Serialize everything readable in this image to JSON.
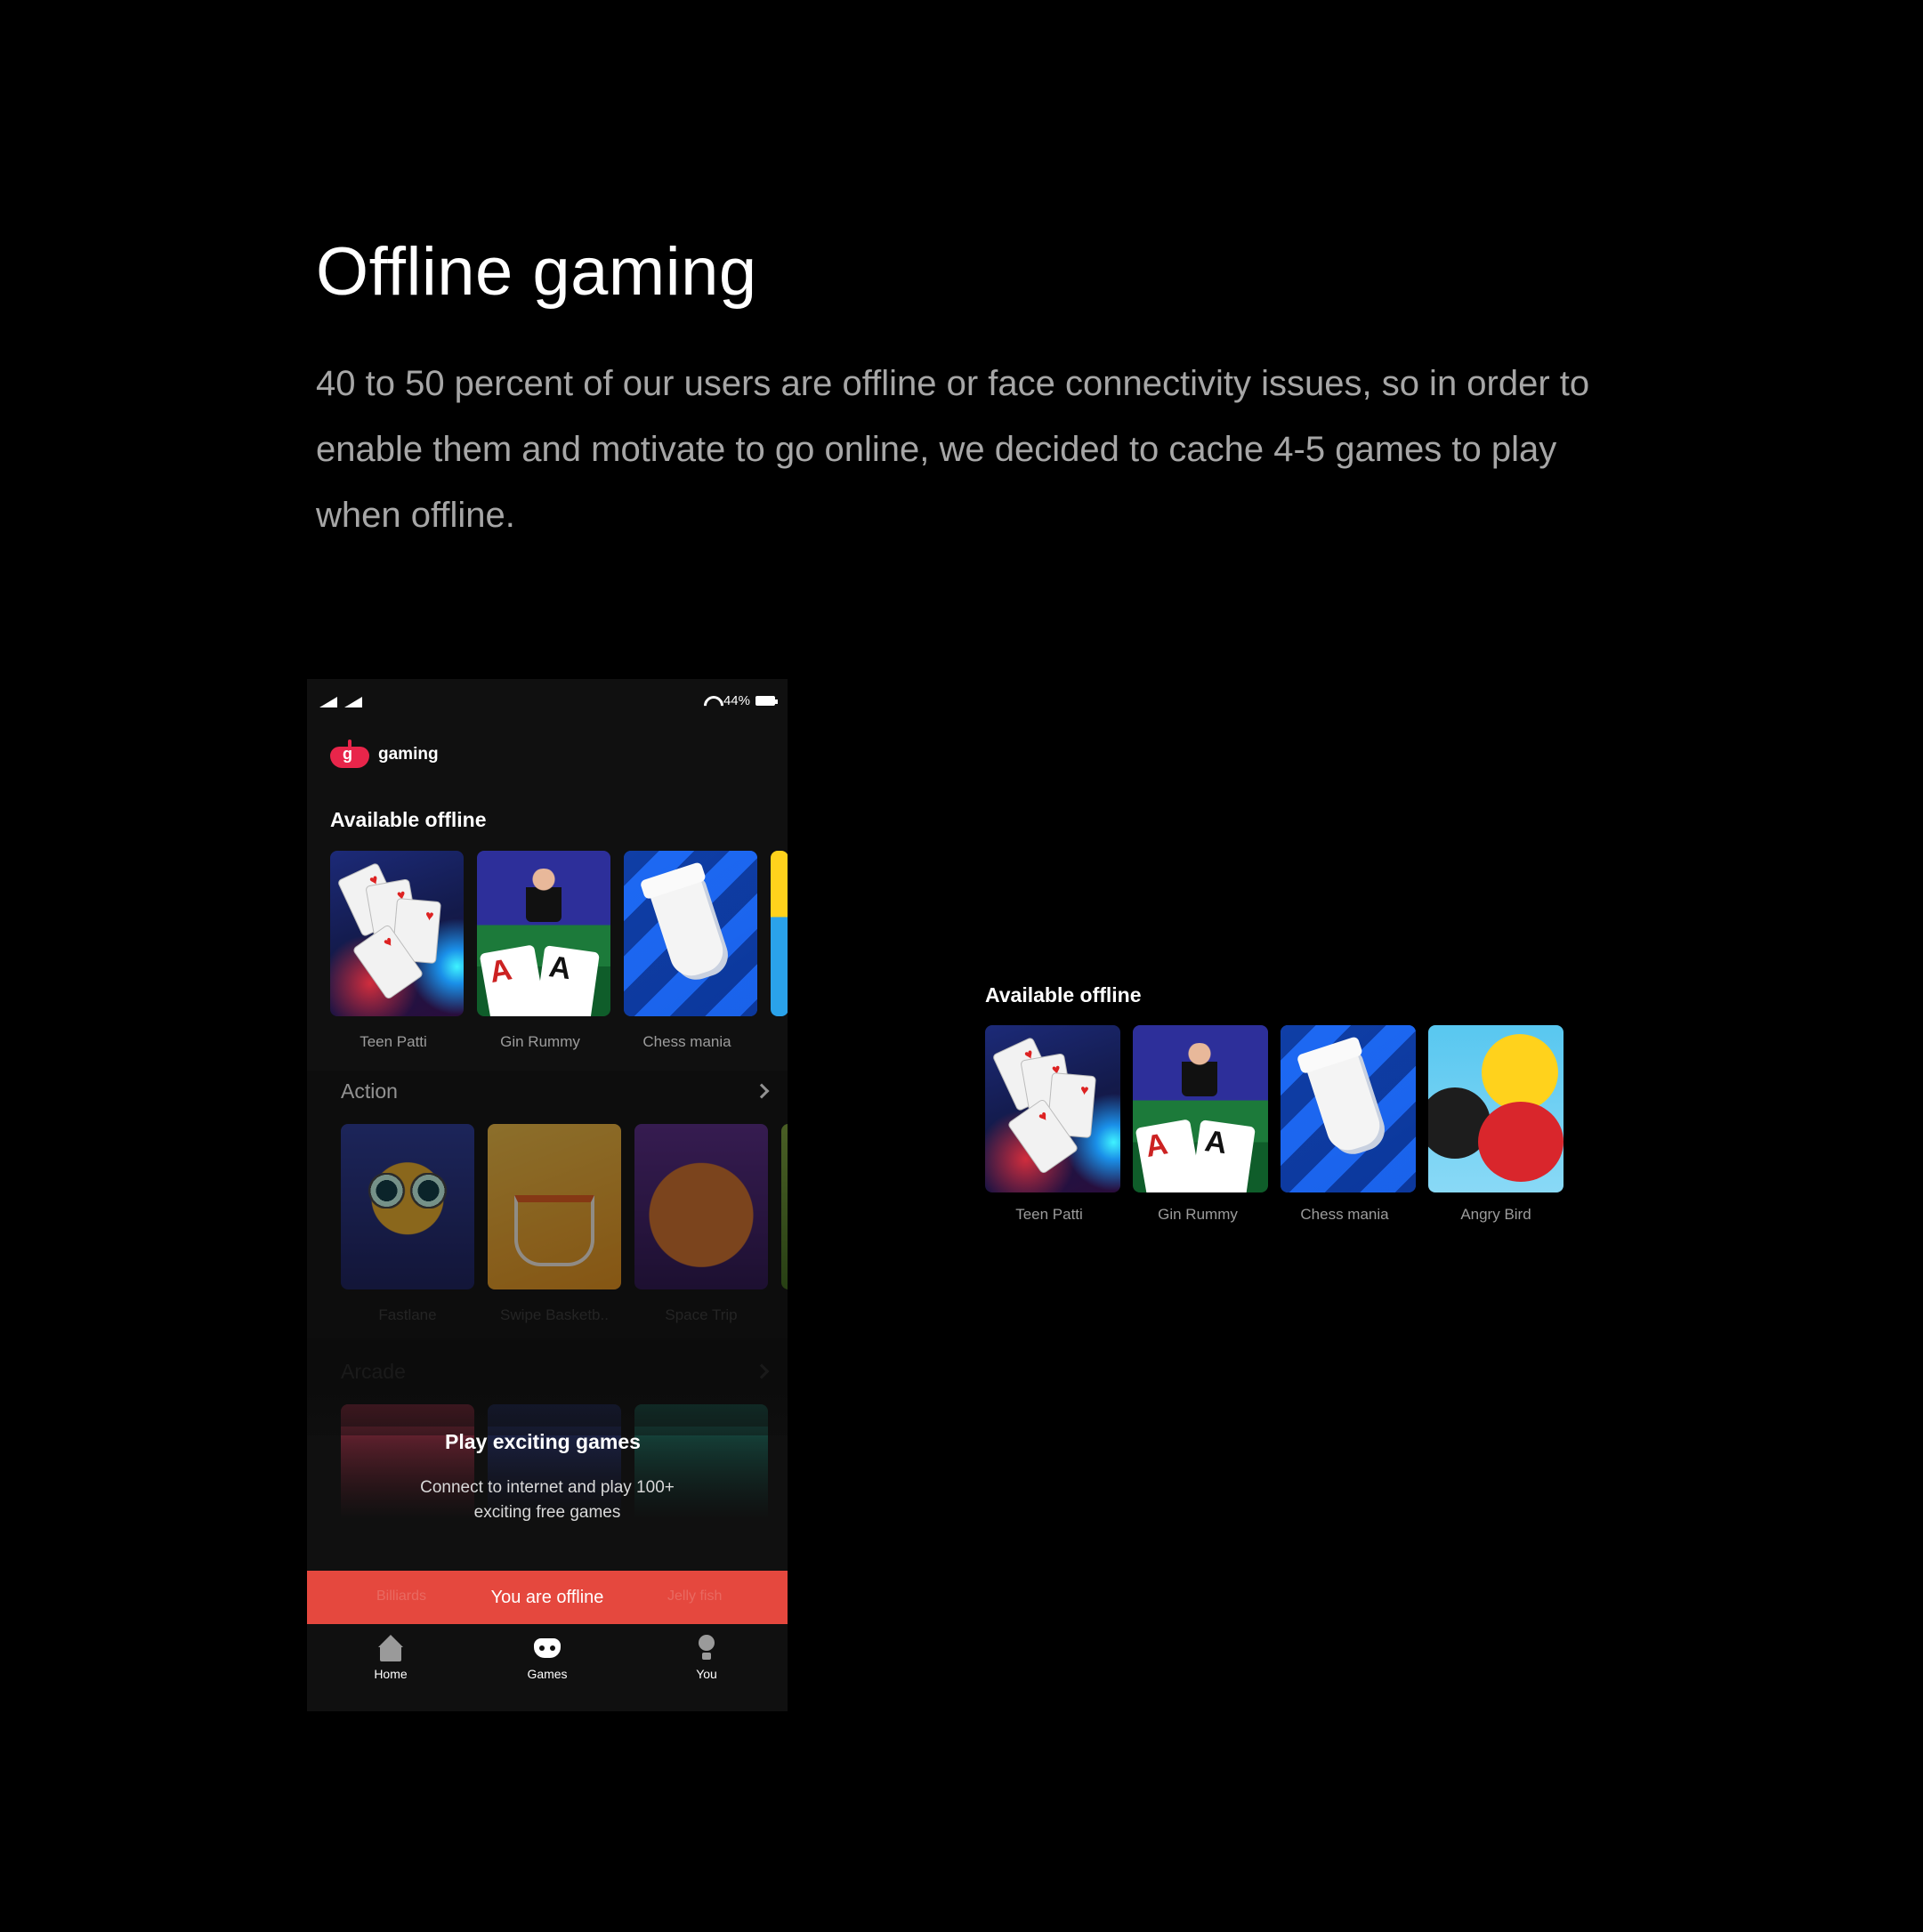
{
  "heading": {
    "title": "Offline gaming",
    "description": "40 to 50 percent of our users are offline or face connectivity issues, so in order to enable them and motivate to go online, we decided to cache 4-5 games to play when offline."
  },
  "phone": {
    "status_bar": {
      "battery": "44%"
    },
    "app": {
      "name": "gaming",
      "logo_letter": "g"
    },
    "available_offline": {
      "title": "Available offline",
      "games": [
        {
          "label": "Teen Patti",
          "icon": "teen-patti-art"
        },
        {
          "label": "Gin Rummy",
          "icon": "gin-rummy-art"
        },
        {
          "label": "Chess mania",
          "icon": "chess-mania-art"
        }
      ]
    },
    "action": {
      "title": "Action",
      "games": [
        {
          "label": "Fastlane"
        },
        {
          "label": "Swipe Basketb.."
        },
        {
          "label": "Space Trip"
        }
      ]
    },
    "arcade": {
      "title": "Arcade"
    },
    "offline_message": {
      "title": "Play exciting games",
      "body": "Connect to internet and play 100+ exciting free games"
    },
    "banner": {
      "text": "You are offline",
      "ghost_left": "Billiards",
      "ghost_right": "Jelly fish"
    },
    "nav": [
      {
        "label": "Home",
        "icon": "home-icon"
      },
      {
        "label": "Games",
        "icon": "gamepad-icon"
      },
      {
        "label": "You",
        "icon": "profile-icon"
      }
    ]
  },
  "zoom": {
    "title": "Available offline",
    "games": [
      {
        "label": "Teen Patti"
      },
      {
        "label": "Gin Rummy"
      },
      {
        "label": "Chess mania"
      },
      {
        "label": "Angry Bird"
      }
    ]
  },
  "colors": {
    "background": "#000000",
    "phone_background": "#101010",
    "offline_banner": "#e5483e",
    "brand": "#e8254a",
    "muted_text": "#a6a6a6"
  }
}
